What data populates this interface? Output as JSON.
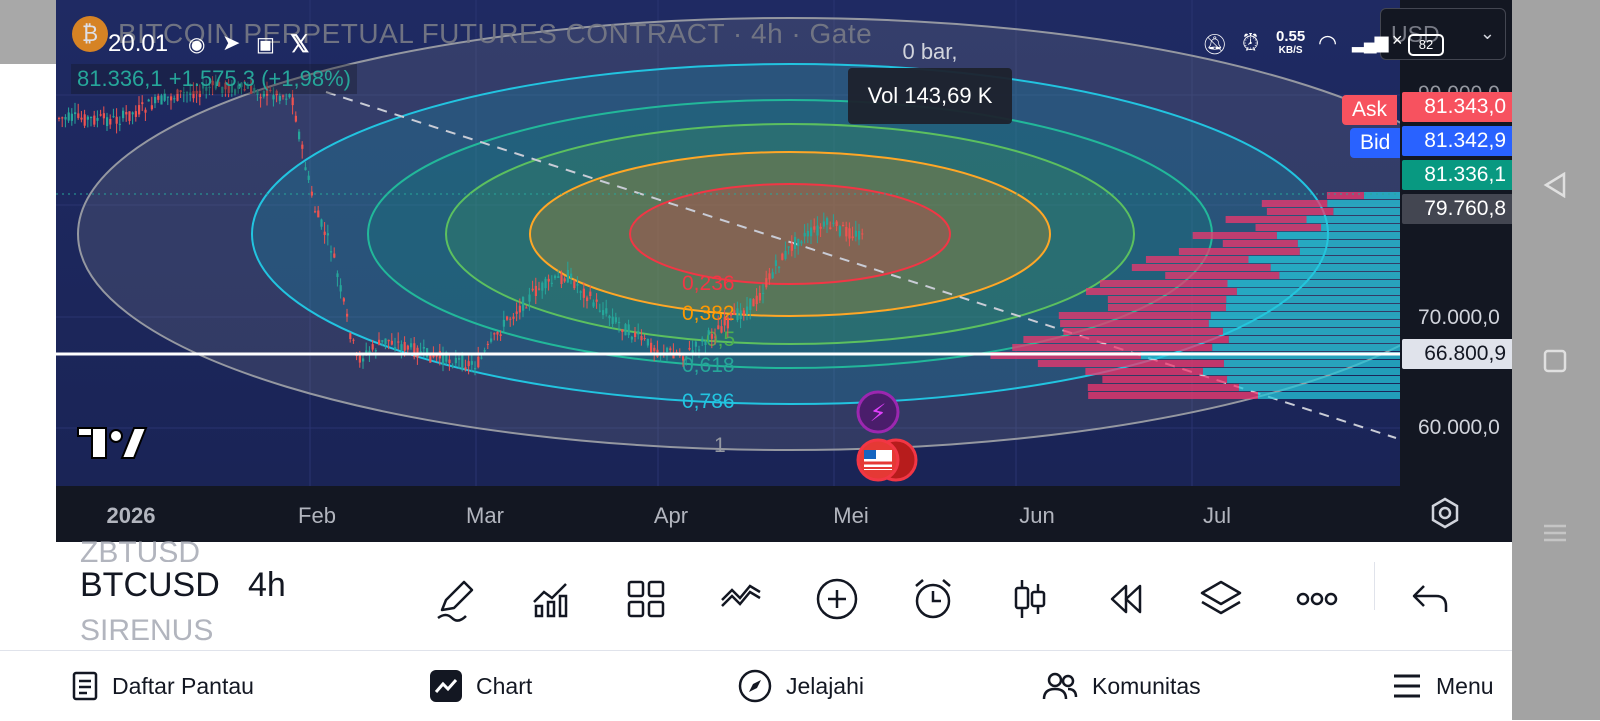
{
  "status": {
    "time": "20.01",
    "net_speed": "0.55",
    "net_unit": "KB/S",
    "battery": "82"
  },
  "chart": {
    "title": "BITCOIN PERPETUAL FUTURES CONTRACT · 4h · Gate",
    "currency": "USD",
    "change_line": "81.336,1  +1.575,3 (+1,98%)",
    "tooltip_line1": "0 bar,",
    "tooltip_line2": "Vol 143,69 K",
    "ask_label": "Ask",
    "bid_label": "Bid",
    "ask_price": "81.343,0",
    "bid_price": "81.342,9",
    "last_price": "81.336,1",
    "prev_price": "79.760,8",
    "crosshair_price": "66.800,9",
    "y_top_partial": "90.000,0",
    "y_labels": [
      "70.000,0",
      "60.000,0"
    ],
    "x_labels": [
      "2026",
      "Feb",
      "Mar",
      "Apr",
      "Mei",
      "Jun",
      "Jul"
    ],
    "fib_levels": [
      "0,236",
      "0,382",
      "0,5",
      "0,618",
      "0,786",
      "1"
    ],
    "fib_colors": [
      "#f23645",
      "#ff9800",
      "#4caf50",
      "#089981",
      "#00bcd4",
      "#787b86"
    ],
    "colors": {
      "ask": "#f7525f",
      "bid": "#2962ff",
      "last": "#089981",
      "prev": "#434651",
      "up": "#26a69a",
      "down": "#ef5350"
    }
  },
  "toolbar": {
    "symbol_prev": "ZBTUSD",
    "symbol": "BTCUSD",
    "symbol_next": "SIRENUS",
    "interval": "4h",
    "icons": [
      "pencil-icon",
      "indicators-icon",
      "grid-icon",
      "patterns-icon",
      "add-icon",
      "alarm-icon",
      "candles-icon",
      "replay-icon",
      "layers-icon",
      "more-icon",
      "undo-icon"
    ]
  },
  "bottomnav": {
    "watchlist": "Daftar Pantau",
    "chart": "Chart",
    "explore": "Jelajahi",
    "community": "Komunitas",
    "menu": "Menu"
  }
}
